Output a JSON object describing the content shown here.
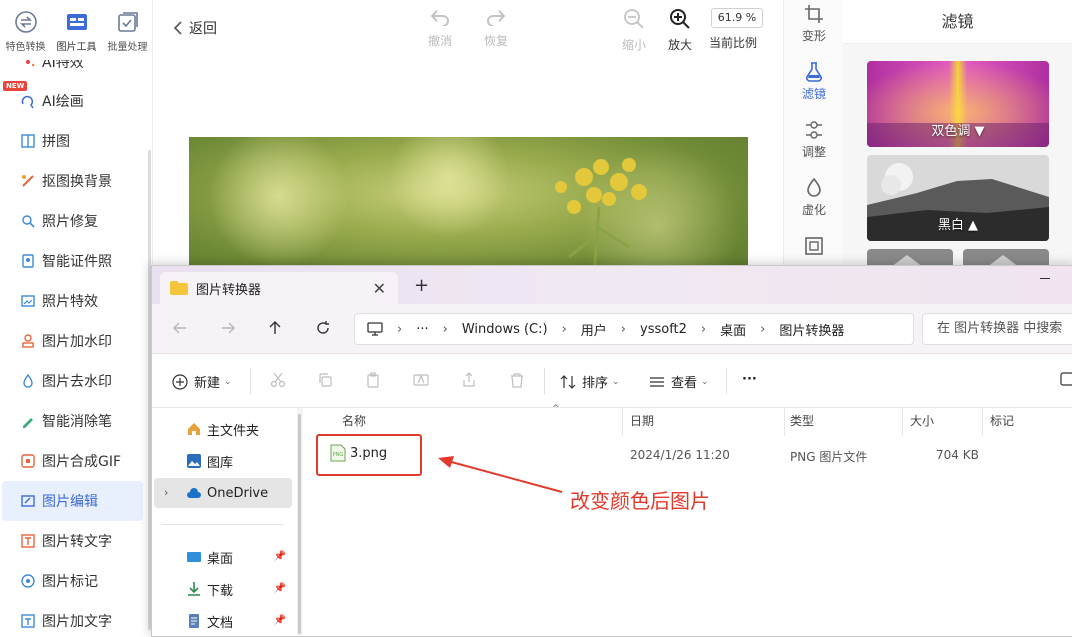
{
  "sidebar": {
    "top_tools": [
      {
        "label": "特色转换",
        "icon": "convert-icon"
      },
      {
        "label": "图片工具",
        "icon": "image-tools-icon"
      },
      {
        "label": "批量处理",
        "icon": "batch-icon"
      }
    ],
    "partial_item": "AI特效",
    "new_badge": "NEW",
    "items": [
      {
        "label": "AI绘画",
        "icon": "ai-paint-icon"
      },
      {
        "label": "拼图",
        "icon": "collage-icon"
      },
      {
        "label": "抠图换背景",
        "icon": "cutout-icon"
      },
      {
        "label": "照片修复",
        "icon": "repair-icon"
      },
      {
        "label": "智能证件照",
        "icon": "id-photo-icon"
      },
      {
        "label": "照片特效",
        "icon": "effects-icon"
      },
      {
        "label": "图片加水印",
        "icon": "watermark-icon"
      },
      {
        "label": "图片去水印",
        "icon": "remove-watermark-icon"
      },
      {
        "label": "智能消除笔",
        "icon": "eraser-icon"
      },
      {
        "label": "图片合成GIF",
        "icon": "gif-icon"
      },
      {
        "label": "图片编辑",
        "icon": "edit-icon",
        "active": true
      },
      {
        "label": "图片转文字",
        "icon": "ocr-icon"
      },
      {
        "label": "图片标记",
        "icon": "mark-icon"
      },
      {
        "label": "图片加文字",
        "icon": "add-text-icon"
      }
    ]
  },
  "editor": {
    "back_label": "返回",
    "undo_label": "撤消",
    "redo_label": "恢复",
    "zoom_out_label": "缩小",
    "zoom_in_label": "放大",
    "zoom_value": "61.9 %",
    "zoom_label": "当前比例"
  },
  "tool_strip": {
    "items": [
      {
        "label": "变形",
        "icon": "transform-icon"
      },
      {
        "label": "滤镜",
        "icon": "filter-icon",
        "active": true
      },
      {
        "label": "调整",
        "icon": "adjust-icon"
      },
      {
        "label": "虚化",
        "icon": "blur-icon"
      }
    ]
  },
  "filter_panel": {
    "title": "滤镜",
    "cards": [
      {
        "label": "双色调 ▼"
      },
      {
        "label": "黑白 ▲"
      }
    ]
  },
  "explorer": {
    "tab_title": "图片转换器",
    "breadcrumbs": [
      "Windows (C:)",
      "用户",
      "yssoft2",
      "桌面",
      "图片转换器"
    ],
    "search_placeholder": "在 图片转换器 中搜索",
    "commands": {
      "new": "新建",
      "sort": "排序",
      "view": "查看",
      "more": "···"
    },
    "nav": [
      {
        "label": "主文件夹",
        "icon": "home-icon"
      },
      {
        "label": "图库",
        "icon": "gallery-icon"
      },
      {
        "label": "OneDrive",
        "icon": "onedrive-icon",
        "selected": true
      },
      {
        "label": "桌面",
        "icon": "desktop-icon",
        "pinned": true
      },
      {
        "label": "下载",
        "icon": "download-icon",
        "pinned": true
      },
      {
        "label": "文档",
        "icon": "documents-icon",
        "pinned": true
      }
    ],
    "columns": [
      "名称",
      "日期",
      "类型",
      "大小",
      "标记"
    ],
    "files": [
      {
        "name": "3.png",
        "date": "2024/1/26 11:20",
        "type": "PNG 图片文件",
        "size": "704 KB",
        "icon_text": "PNG"
      }
    ]
  },
  "annotation": {
    "text": "改变颜色后图片",
    "color": "#e23a2c"
  },
  "colors": {
    "accent": "#3d6bd8",
    "active_bg": "#e8effd"
  }
}
